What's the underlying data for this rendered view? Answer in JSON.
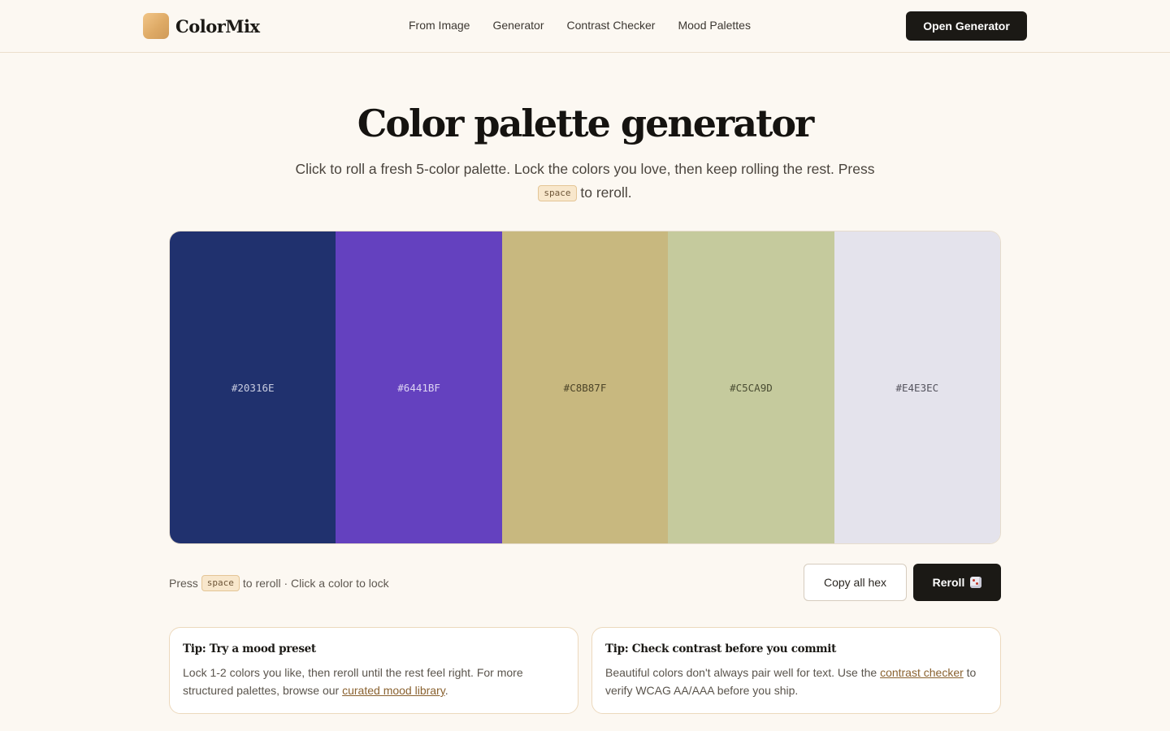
{
  "header": {
    "brand": "ColorMix",
    "nav": [
      "From Image",
      "Generator",
      "Contrast Checker",
      "Mood Palettes"
    ],
    "cta": "Open Generator"
  },
  "hero": {
    "title": "Color palette generator",
    "subtitle_before": "Click to roll a fresh 5-color palette. Lock the colors you love, then keep rolling the rest. Press",
    "key": "space",
    "subtitle_after": "to reroll."
  },
  "palette": {
    "swatches": [
      {
        "hex": "#20316E",
        "text_color": "#c9cde0"
      },
      {
        "hex": "#6441BF",
        "text_color": "#ddd4f3"
      },
      {
        "hex": "#C8B87F",
        "text_color": "#4c4428"
      },
      {
        "hex": "#C5CA9D",
        "text_color": "#4a4d33"
      },
      {
        "hex": "#E4E3EC",
        "text_color": "#55545e"
      }
    ]
  },
  "controls": {
    "hint_before": "Press",
    "key": "space",
    "hint_after": "to reroll · Click a color to lock",
    "copy_label": "Copy all hex",
    "reroll_label": "Reroll"
  },
  "tips": {
    "left": {
      "title": "Tip: Try a mood preset",
      "text_before": "Lock 1-2 colors you like, then reroll until the rest feel right. For more structured palettes, browse our",
      "link": "curated mood library",
      "text_after": "."
    },
    "right": {
      "title": "Tip: Check contrast before you commit",
      "text_before": "Beautiful colors don't always pair well for text. Use the",
      "link": "contrast checker",
      "text_after": "to verify WCAG AA/AAA before you ship."
    }
  }
}
